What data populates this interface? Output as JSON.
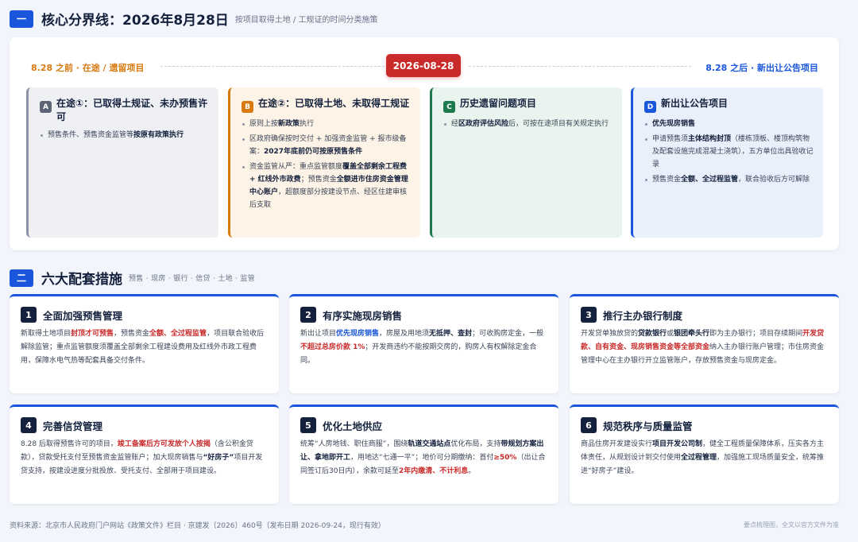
{
  "section1": {
    "num": "一",
    "title": "核心分界线：2026年8月28日",
    "subtitle": "按项目取得土地 / 工规证的时间分类施策"
  },
  "timeline": {
    "left_label": "8.28 之前 · 在途 / 遗留项目",
    "right_label": "8.28 之后 · 新出让公告项目",
    "date": "2026-08-28"
  },
  "categories": [
    {
      "badge": "A",
      "title": "在途①：已取得土规证、未办预售许可",
      "items": [
        [
          {
            "t": "预售条件、预售资金监管等"
          },
          {
            "t": "按原有政策执行",
            "s": "bold"
          }
        ]
      ]
    },
    {
      "badge": "B",
      "title": "在途②：已取得土地、未取得工规证",
      "items": [
        [
          {
            "t": "原则上按"
          },
          {
            "t": "新政策",
            "s": "bold"
          },
          {
            "t": "执行"
          }
        ],
        [
          {
            "t": "区政府确保按时交付 + 加强资金监管 + 报市级备案："
          },
          {
            "t": "2027年底前仍可按原预售条件",
            "s": "bold"
          }
        ],
        [
          {
            "t": "资金监管从严：重点监管额度"
          },
          {
            "t": "覆盖全部剩余工程费 + 红线外市政费",
            "s": "bold"
          },
          {
            "t": "；预售资金"
          },
          {
            "t": "全额进市住房资金管理中心账户",
            "s": "bold"
          },
          {
            "t": "，超额度部分按建设节点、经区住建审核后支取"
          }
        ]
      ]
    },
    {
      "badge": "C",
      "title": "历史遗留问题项目",
      "items": [
        [
          {
            "t": "经"
          },
          {
            "t": "区政府评估风险",
            "s": "bold"
          },
          {
            "t": "后，可按在途项目有关规定执行"
          }
        ]
      ]
    },
    {
      "badge": "D",
      "title": "新出让公告项目",
      "items": [
        [
          {
            "t": "优先现房销售",
            "s": "bold"
          }
        ],
        [
          {
            "t": "申请预售须"
          },
          {
            "t": "主体结构封顶",
            "s": "bold"
          },
          {
            "t": "（楼栋顶板、楼顶构筑物及配套设施完成混凝土浇筑），五方单位出具验收记录"
          }
        ],
        [
          {
            "t": "预售资金"
          },
          {
            "t": "全额、全过程监管",
            "s": "bold"
          },
          {
            "t": "，联合验收后方可解除"
          }
        ]
      ]
    }
  ],
  "section2": {
    "num": "二",
    "title": "六大配套措施",
    "subtitle": "预售 · 现房 · 银行 · 信贷 · 土地 · 监管"
  },
  "measures": [
    {
      "num": "1",
      "title": "全面加强预售管理",
      "body": [
        {
          "t": "新取得土地项目"
        },
        {
          "t": "封顶才可预售",
          "s": "red"
        },
        {
          "t": "，预售资金"
        },
        {
          "t": "全额、全过程监管",
          "s": "red"
        },
        {
          "t": "，项目联合验收后解除监管；重点监管额度须覆盖全部剩余工程建设费用及红线外市政工程费用，保障水电气热等配套具备交付条件。"
        }
      ]
    },
    {
      "num": "2",
      "title": "有序实施现房销售",
      "body": [
        {
          "t": "新出让项目"
        },
        {
          "t": "优先现房销售",
          "s": "blue"
        },
        {
          "t": "，房屋及用地须"
        },
        {
          "t": "无抵押、查封",
          "s": "bold"
        },
        {
          "t": "；可收购房定金，一般"
        },
        {
          "t": "不超过总房价款 1%",
          "s": "red"
        },
        {
          "t": "；开发商违约不能按期交房的，购房人有权解除定金合同。"
        }
      ]
    },
    {
      "num": "3",
      "title": "推行主办银行制度",
      "body": [
        {
          "t": "开发贷单独放贷的"
        },
        {
          "t": "贷款银行",
          "s": "bold"
        },
        {
          "t": "或"
        },
        {
          "t": "银团牵头行",
          "s": "bold"
        },
        {
          "t": "即为主办银行；项目存续期间"
        },
        {
          "t": "开发贷款、自有资金、现房销售资金等全部资金",
          "s": "red"
        },
        {
          "t": "纳入主办银行账户管理；市住房资金管理中心在主办银行开立监管账户，存放预售资金与现房定金。"
        }
      ]
    },
    {
      "num": "4",
      "title": "完善信贷管理",
      "body": [
        {
          "t": "8.28 后取得预售许可的项目，"
        },
        {
          "t": "竣工备案后方可发放个人按揭",
          "s": "red"
        },
        {
          "t": "（含公积金贷款），贷款受托支付至预售资金监管账户；加大现房销售与"
        },
        {
          "t": "“好房子”",
          "s": "bold"
        },
        {
          "t": "项目开发贷支持，按建设进度分批投放、受托支付、全部用于项目建设。"
        }
      ]
    },
    {
      "num": "5",
      "title": "优化土地供应",
      "body": [
        {
          "t": "统筹“人房地钱、职住商服”，围绕"
        },
        {
          "t": "轨道交通站点",
          "s": "bold"
        },
        {
          "t": "优化布局，支持"
        },
        {
          "t": "带规划方案出让、拿地即开工",
          "s": "bold"
        },
        {
          "t": "，用地达“七通一平”；地价可分期缴纳：首付"
        },
        {
          "t": "≥50%",
          "s": "red"
        },
        {
          "t": "（出让合同签订后30日内），余款可延至"
        },
        {
          "t": "2年内缴清、不计利息",
          "s": "red"
        },
        {
          "t": "。"
        }
      ]
    },
    {
      "num": "6",
      "title": "规范秩序与质量监管",
      "body": [
        {
          "t": "商品住房开发建设实行"
        },
        {
          "t": "项目开发公司制",
          "s": "bold"
        },
        {
          "t": "，健全工程质量保障体系，压实各方主体责任，从规划设计到交付使用"
        },
        {
          "t": "全过程管理",
          "s": "bold"
        },
        {
          "t": "，加强施工现场质量安全，统筹推进“好房子”建设。"
        }
      ]
    }
  ],
  "footer": {
    "source": "资料来源：北京市人民政府门户网站《政策文件》栏目 · 京建发〔2026〕460号（发布日期 2026-09-24，现行有效）",
    "note": "要点梳理图，全文以官方文件为准"
  },
  "colors": {
    "accent": "#1a56db",
    "red": "#c92a2a",
    "orange": "#d77a10",
    "green": "#1e7a4e",
    "gray": "#6b7488"
  }
}
